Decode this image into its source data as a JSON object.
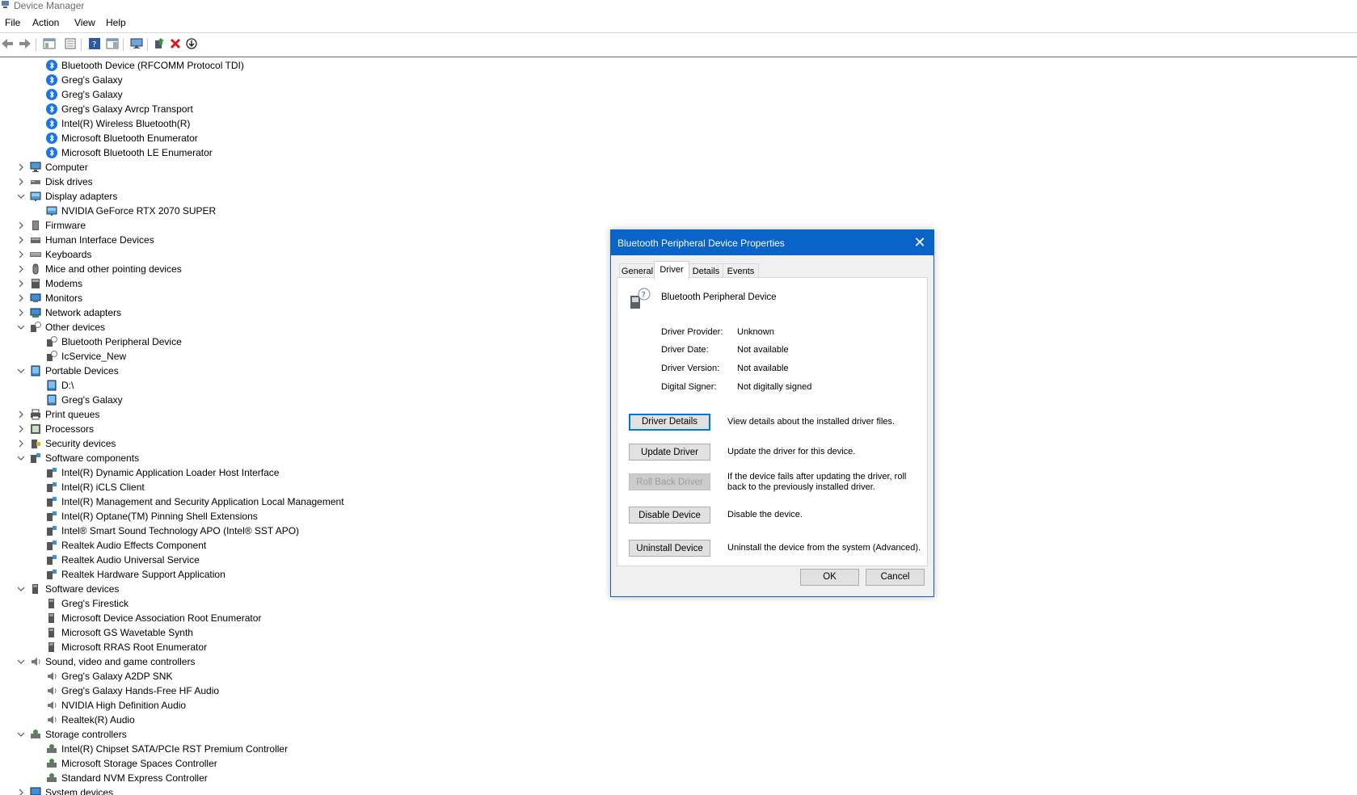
{
  "window": {
    "title": "Device Manager"
  },
  "menu": [
    "File",
    "Action",
    "View",
    "Help"
  ],
  "toolbar": [
    "back-icon",
    "forward-icon",
    "show-hide-console-tree-icon",
    "properties-icon",
    "help-icon",
    "action-pane-icon",
    "display-icon",
    "update-driver-icon",
    "uninstall-icon",
    "download-icon"
  ],
  "tree": [
    {
      "level": 2,
      "label": "Bluetooth Device (RFCOMM Protocol TDI)",
      "icon": "bluetooth-icon"
    },
    {
      "level": 2,
      "label": "Greg's Galaxy",
      "icon": "bluetooth-icon"
    },
    {
      "level": 2,
      "label": "Greg's Galaxy",
      "icon": "bluetooth-icon"
    },
    {
      "level": 2,
      "label": "Greg's Galaxy Avrcp Transport",
      "icon": "bluetooth-icon"
    },
    {
      "level": 2,
      "label": "Intel(R) Wireless Bluetooth(R)",
      "icon": "bluetooth-icon"
    },
    {
      "level": 2,
      "label": "Microsoft Bluetooth Enumerator",
      "icon": "bluetooth-icon"
    },
    {
      "level": 2,
      "label": "Microsoft Bluetooth LE Enumerator",
      "icon": "bluetooth-icon"
    },
    {
      "level": 1,
      "label": "Computer",
      "icon": "computer-icon",
      "state": "collapsed"
    },
    {
      "level": 1,
      "label": "Disk drives",
      "icon": "disk-drive-icon",
      "state": "collapsed"
    },
    {
      "level": 1,
      "label": "Display adapters",
      "icon": "display-adapter-icon",
      "state": "expanded"
    },
    {
      "level": 2,
      "label": "NVIDIA GeForce RTX 2070 SUPER",
      "icon": "display-adapter-icon"
    },
    {
      "level": 1,
      "label": "Firmware",
      "icon": "firmware-icon",
      "state": "collapsed"
    },
    {
      "level": 1,
      "label": "Human Interface Devices",
      "icon": "hid-icon",
      "state": "collapsed"
    },
    {
      "level": 1,
      "label": "Keyboards",
      "icon": "keyboard-icon",
      "state": "collapsed"
    },
    {
      "level": 1,
      "label": "Mice and other pointing devices",
      "icon": "mouse-icon",
      "state": "collapsed"
    },
    {
      "level": 1,
      "label": "Modems",
      "icon": "modem-icon",
      "state": "collapsed"
    },
    {
      "level": 1,
      "label": "Monitors",
      "icon": "monitor-icon",
      "state": "collapsed"
    },
    {
      "level": 1,
      "label": "Network adapters",
      "icon": "network-adapter-icon",
      "state": "collapsed"
    },
    {
      "level": 1,
      "label": "Other devices",
      "icon": "other-devices-icon",
      "state": "expanded"
    },
    {
      "level": 2,
      "label": "Bluetooth Peripheral Device",
      "icon": "unknown-device-icon"
    },
    {
      "level": 2,
      "label": "IcService_New",
      "icon": "unknown-device-icon"
    },
    {
      "level": 1,
      "label": "Portable Devices",
      "icon": "portable-device-icon",
      "state": "expanded"
    },
    {
      "level": 2,
      "label": "D:\\",
      "icon": "portable-device-icon"
    },
    {
      "level": 2,
      "label": "Greg's Galaxy",
      "icon": "portable-device-icon"
    },
    {
      "level": 1,
      "label": "Print queues",
      "icon": "printer-icon",
      "state": "collapsed"
    },
    {
      "level": 1,
      "label": "Processors",
      "icon": "processor-icon",
      "state": "collapsed"
    },
    {
      "level": 1,
      "label": "Security devices",
      "icon": "security-device-icon",
      "state": "collapsed"
    },
    {
      "level": 1,
      "label": "Software components",
      "icon": "software-component-icon",
      "state": "expanded"
    },
    {
      "level": 2,
      "label": "Intel(R) Dynamic Application Loader Host Interface",
      "icon": "software-component-icon"
    },
    {
      "level": 2,
      "label": "Intel(R) iCLS Client",
      "icon": "software-component-icon"
    },
    {
      "level": 2,
      "label": "Intel(R) Management and Security Application Local Management",
      "icon": "software-component-icon"
    },
    {
      "level": 2,
      "label": "Intel(R) Optane(TM) Pinning Shell Extensions",
      "icon": "software-component-icon"
    },
    {
      "level": 2,
      "label": "Intel® Smart Sound Technology APO (Intel® SST APO)",
      "icon": "software-component-icon"
    },
    {
      "level": 2,
      "label": "Realtek Audio Effects Component",
      "icon": "software-component-icon"
    },
    {
      "level": 2,
      "label": "Realtek Audio Universal Service",
      "icon": "software-component-icon"
    },
    {
      "level": 2,
      "label": "Realtek Hardware Support Application",
      "icon": "software-component-icon"
    },
    {
      "level": 1,
      "label": "Software devices",
      "icon": "software-device-icon",
      "state": "expanded"
    },
    {
      "level": 2,
      "label": "Greg's Firestick",
      "icon": "software-device-icon"
    },
    {
      "level": 2,
      "label": "Microsoft Device Association Root Enumerator",
      "icon": "software-device-icon"
    },
    {
      "level": 2,
      "label": "Microsoft GS Wavetable Synth",
      "icon": "software-device-icon"
    },
    {
      "level": 2,
      "label": "Microsoft RRAS Root Enumerator",
      "icon": "software-device-icon"
    },
    {
      "level": 1,
      "label": "Sound, video and game controllers",
      "icon": "speaker-icon",
      "state": "expanded"
    },
    {
      "level": 2,
      "label": "Greg's Galaxy A2DP SNK",
      "icon": "speaker-icon"
    },
    {
      "level": 2,
      "label": "Greg's Galaxy Hands-Free HF Audio",
      "icon": "speaker-icon"
    },
    {
      "level": 2,
      "label": "NVIDIA High Definition Audio",
      "icon": "speaker-icon"
    },
    {
      "level": 2,
      "label": "Realtek(R) Audio",
      "icon": "speaker-icon"
    },
    {
      "level": 1,
      "label": "Storage controllers",
      "icon": "storage-controller-icon",
      "state": "expanded"
    },
    {
      "level": 2,
      "label": "Intel(R) Chipset SATA/PCIe RST Premium Controller",
      "icon": "storage-controller-icon"
    },
    {
      "level": 2,
      "label": "Microsoft Storage Spaces Controller",
      "icon": "storage-controller-icon"
    },
    {
      "level": 2,
      "label": "Standard NVM Express Controller",
      "icon": "storage-controller-icon"
    },
    {
      "level": 1,
      "label": "System devices",
      "icon": "system-device-icon",
      "state": "collapsed"
    }
  ],
  "dialog": {
    "title": "Bluetooth Peripheral Device Properties",
    "tabs": [
      "General",
      "Driver",
      "Details",
      "Events"
    ],
    "active_tab": "Driver",
    "device_name": "Bluetooth Peripheral Device",
    "fields": [
      {
        "label": "Driver Provider:",
        "value": "Unknown"
      },
      {
        "label": "Driver Date:",
        "value": "Not available"
      },
      {
        "label": "Driver Version:",
        "value": "Not available"
      },
      {
        "label": "Digital Signer:",
        "value": "Not digitally signed"
      }
    ],
    "actions": [
      {
        "label": "Driver Details",
        "desc": "View details about the installed driver files."
      },
      {
        "label": "Update Driver",
        "desc": "Update the driver for this device."
      },
      {
        "label": "Roll Back Driver",
        "desc": "If the device fails after updating the driver, roll back to the previously installed driver."
      },
      {
        "label": "Disable Device",
        "desc": "Disable the device."
      },
      {
        "label": "Uninstall Device",
        "desc": "Uninstall the device from the system (Advanced)."
      }
    ],
    "ok_label": "OK",
    "cancel_label": "Cancel"
  },
  "colors": {
    "accent": "#0a64c8",
    "bluetooth": "#1a73e8"
  }
}
